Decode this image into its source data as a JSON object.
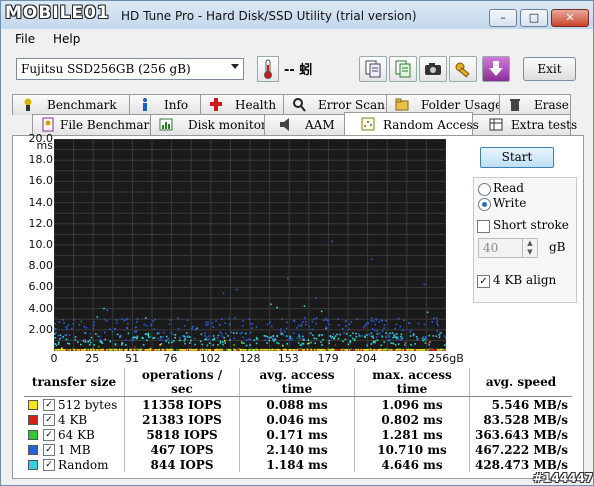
{
  "window": {
    "watermark_logo": "MOBILE01",
    "title": "HD Tune Pro - Hard Disk/SSD Utility (trial version)",
    "controls": {
      "minimize": "–",
      "maximize": "□",
      "close": "✕"
    },
    "watermark_id": "#144447"
  },
  "menu": {
    "file": "File",
    "help": "Help"
  },
  "toolbar": {
    "drive": "Fujitsu SSD256GB (256 gB)",
    "temperature": "-- 蚓",
    "exit_label": "Exit",
    "icons": [
      "thermometer-icon",
      "copy-info-icon",
      "copy-text-icon",
      "screenshot-camera-icon",
      "options-wrench-icon",
      "download-icon"
    ]
  },
  "tabs_row1": [
    "Benchmark",
    "Info",
    "Health",
    "Error Scan",
    "Folder Usage",
    "Erase"
  ],
  "tabs_row2": [
    "File Benchmark",
    "Disk monitor",
    "AAM",
    "Random Access",
    "Extra tests"
  ],
  "active_tab": "Random Access",
  "controls": {
    "start": "Start",
    "read": "Read",
    "write": "Write",
    "mode_selected": "Write",
    "short_stroke": "Short stroke",
    "short_stroke_checked": false,
    "stroke_value": "40",
    "stroke_unit": "gB",
    "align": "4 KB align",
    "align_checked": true
  },
  "chart_data": {
    "type": "scatter",
    "y_unit": "ms",
    "x_unit": "256gB",
    "yticks": [
      "20.0",
      "18.0",
      "16.0",
      "14.0",
      "12.0",
      "10.0",
      "8.00",
      "6.00",
      "4.00",
      "2.00"
    ],
    "xticks": [
      "0",
      "25",
      "51",
      "76",
      "102",
      "128",
      "153",
      "179",
      "204",
      "230"
    ],
    "ylim": [
      0,
      20
    ],
    "xlim": [
      0,
      256
    ],
    "grid": true,
    "series": [
      {
        "name": "512 bytes",
        "color": "#f5e51c",
        "mean_ms": 0.088,
        "max_ms": 1.096
      },
      {
        "name": "4 KB",
        "color": "#d01f1f",
        "mean_ms": 0.046,
        "max_ms": 0.802
      },
      {
        "name": "64 KB",
        "color": "#32c832",
        "mean_ms": 0.171,
        "max_ms": 1.281
      },
      {
        "name": "1 MB",
        "color": "#2b5fd9",
        "mean_ms": 2.14,
        "max_ms": 10.71
      },
      {
        "name": "Random",
        "color": "#33d1d8",
        "mean_ms": 1.184,
        "max_ms": 4.646
      }
    ]
  },
  "results": {
    "headers": [
      "transfer size",
      "operations / sec",
      "avg. access time",
      "max. access time",
      "avg. speed"
    ],
    "rows": [
      {
        "size": "512 bytes",
        "color": "#f5e51c",
        "iops": "11358 IOPS",
        "avg": "0.088 ms",
        "max": "1.096 ms",
        "speed": "5.546 MB/s"
      },
      {
        "size": "4 KB",
        "color": "#d01f1f",
        "iops": "21383 IOPS",
        "avg": "0.046 ms",
        "max": "0.802 ms",
        "speed": "83.528 MB/s"
      },
      {
        "size": "64 KB",
        "color": "#32c832",
        "iops": "5818 IOPS",
        "avg": "0.171 ms",
        "max": "1.281 ms",
        "speed": "363.643 MB/s"
      },
      {
        "size": "1 MB",
        "color": "#2b5fd9",
        "iops": "467 IOPS",
        "avg": "2.140 ms",
        "max": "10.710 ms",
        "speed": "467.222 MB/s"
      },
      {
        "size": "Random",
        "color": "#33d1d8",
        "iops": "844 IOPS",
        "avg": "1.184 ms",
        "max": "4.646 ms",
        "speed": "428.473 MB/s"
      }
    ]
  }
}
